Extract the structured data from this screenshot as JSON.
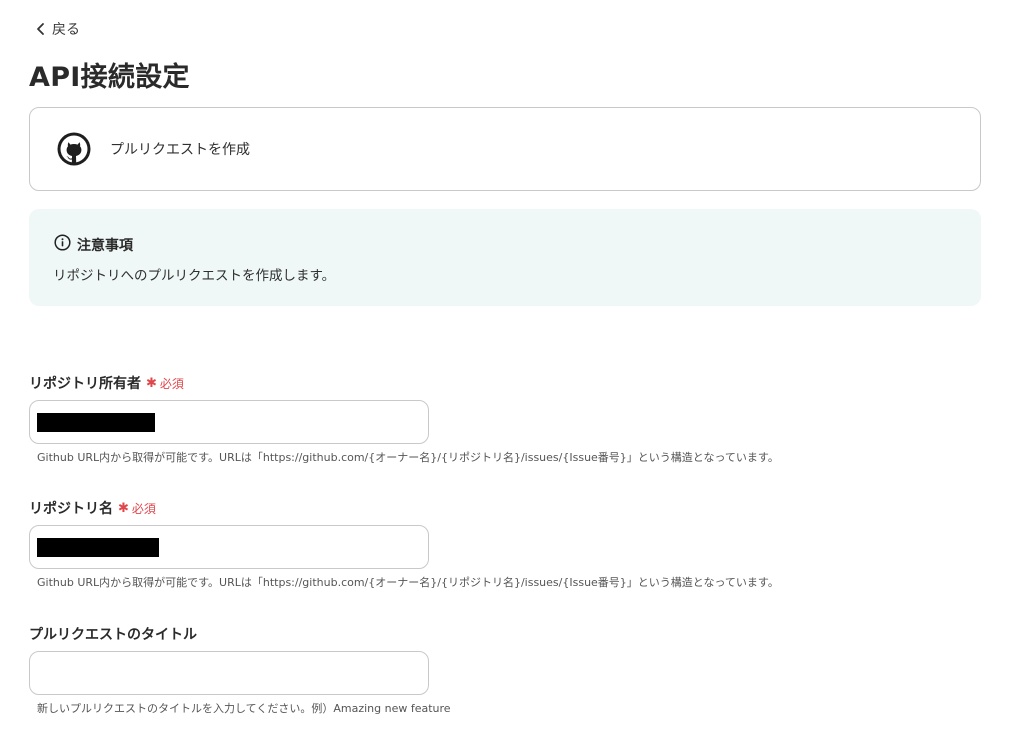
{
  "nav": {
    "back_label": "戻る"
  },
  "page": {
    "title": "API接続設定"
  },
  "action": {
    "name": "プルリクエストを作成"
  },
  "notice": {
    "heading": "注意事項",
    "body": "リポジトリへのプルリクエストを作成します。"
  },
  "fields": [
    {
      "label": "リポジトリ所有者",
      "required_label": "必須",
      "value_redacted": true,
      "help": "Github URL内から取得が可能です。URLは「https://github.com/{オーナー名}/{リポジトリ名}/issues/{Issue番号}」という構造となっています。"
    },
    {
      "label": "リポジトリ名",
      "required_label": "必須",
      "value_redacted": true,
      "help": "Github URL内から取得が可能です。URLは「https://github.com/{オーナー名}/{リポジトリ名}/issues/{Issue番号}」という構造となっています。"
    },
    {
      "label": "プルリクエストのタイトル",
      "value": "",
      "help": "新しいプルリクエストのタイトルを入力してください。例）Amazing new feature"
    }
  ],
  "icons": {
    "back": "chevron-left-icon",
    "app": "github-icon",
    "notice": "info-icon"
  },
  "colors": {
    "required": "#e0474c",
    "notice_bg": "#f0f8f7",
    "border": "#c9c9c9"
  }
}
